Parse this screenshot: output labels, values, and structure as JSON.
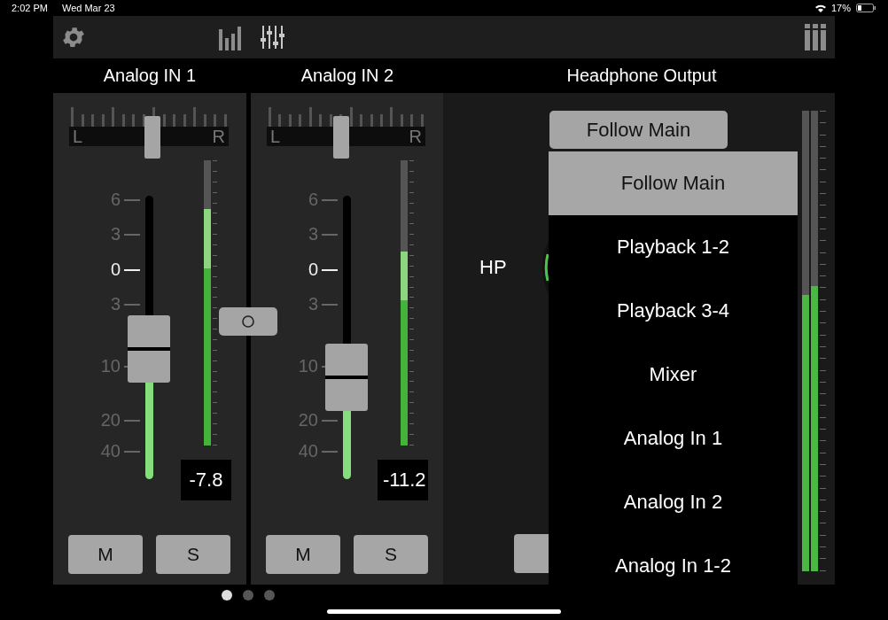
{
  "status_bar": {
    "time": "2:02 PM",
    "date": "Wed Mar 23",
    "battery": "17%"
  },
  "toolbar": {
    "items": [
      {
        "kind": "settings",
        "selected": false
      },
      {
        "kind": "meters",
        "selected": false
      },
      {
        "kind": "mixer",
        "selected": true
      },
      {
        "kind": "columns",
        "selected": false
      }
    ]
  },
  "channels": [
    {
      "title": "Analog IN 1",
      "pan": {
        "left": "L",
        "right": "R",
        "level": 0.52
      },
      "scale": [
        "6",
        "3",
        "0",
        "3",
        "10",
        "20",
        "40"
      ],
      "fader": {
        "level": 0.46
      },
      "meter": {
        "level": 0.83
      },
      "reading": "-7.8",
      "mute": {
        "label": "M",
        "on": false
      },
      "solo": {
        "label": "S",
        "on": false
      }
    },
    {
      "title": "Analog IN 2",
      "pan": {
        "left": "L",
        "right": "R",
        "level": 0.47
      },
      "scale": [
        "6",
        "3",
        "0",
        "3",
        "10",
        "20",
        "40"
      ],
      "fader": {
        "level": 0.36
      },
      "meter": {
        "level": 0.68
      },
      "reading": "-11.2",
      "mute": {
        "label": "M",
        "on": false
      },
      "solo": {
        "label": "S",
        "on": false
      }
    }
  ],
  "link": {
    "on": false
  },
  "headphone": {
    "title": "Headphone Output",
    "label": "HP",
    "source_button": "Follow Main",
    "mute": {
      "on": false
    },
    "meter": [
      {
        "level": 0.6
      },
      {
        "level": 0.62
      }
    ],
    "menu": [
      {
        "label": "Follow Main",
        "selected": true
      },
      {
        "label": "Playback 1-2",
        "selected": false
      },
      {
        "label": "Playback 3-4",
        "selected": false
      },
      {
        "label": "Mixer",
        "selected": false
      },
      {
        "label": "Analog In 1",
        "selected": false
      },
      {
        "label": "Analog In 2",
        "selected": false
      },
      {
        "label": "Analog In 1-2",
        "selected": false
      }
    ]
  },
  "pages": [
    {
      "selected": true
    },
    {
      "selected": false
    },
    {
      "selected": false
    }
  ]
}
